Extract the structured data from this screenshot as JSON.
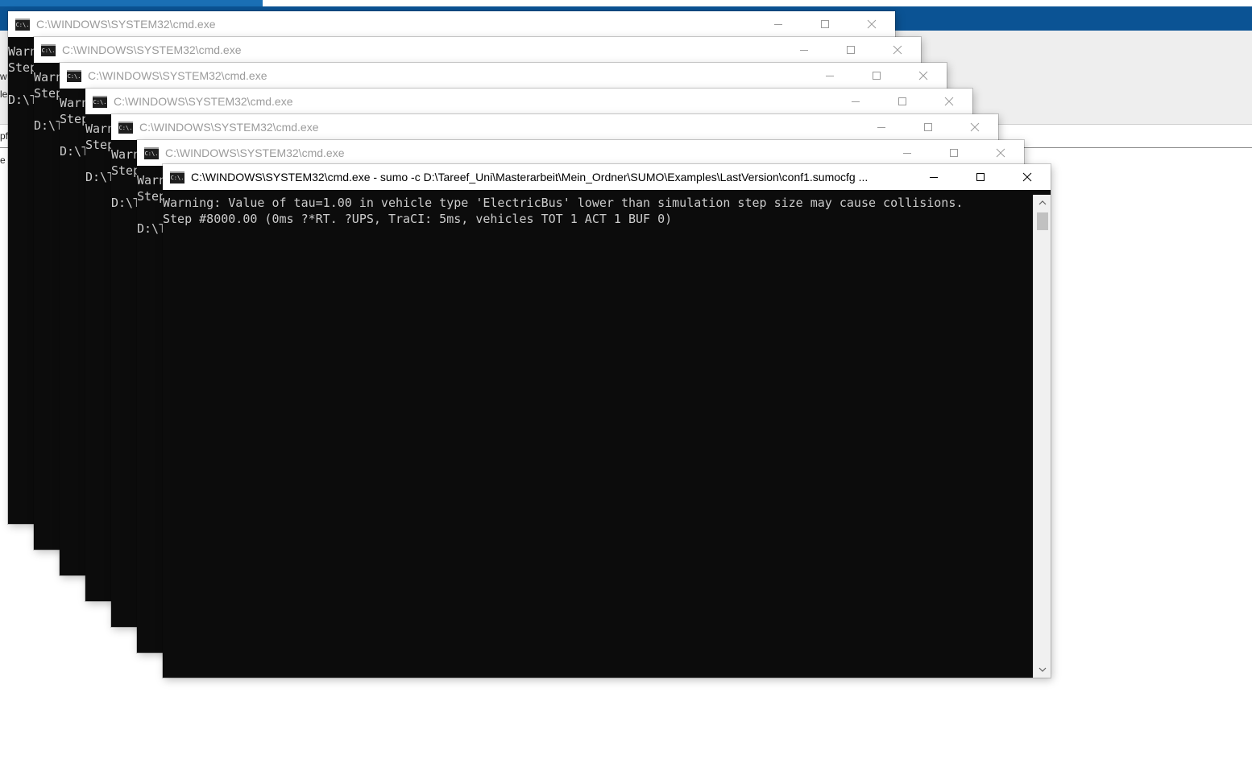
{
  "background_app": {
    "fragments": [
      "w",
      "le",
      "pf",
      "e"
    ]
  },
  "windows": [
    {
      "title": "C:\\WINDOWS\\SYSTEM32\\cmd.exe",
      "lines": [
        "Warn",
        "Step",
        "",
        "D:\\T"
      ]
    },
    {
      "title": "C:\\WINDOWS\\SYSTEM32\\cmd.exe",
      "lines": [
        "Warn",
        "Step",
        "",
        "D:\\T"
      ]
    },
    {
      "title": "C:\\WINDOWS\\SYSTEM32\\cmd.exe",
      "lines": [
        "Warn",
        "Step",
        "",
        "D:\\T"
      ]
    },
    {
      "title": "C:\\WINDOWS\\SYSTEM32\\cmd.exe",
      "lines": [
        "Warn",
        "Step",
        "",
        "D:\\T"
      ]
    },
    {
      "title": "C:\\WINDOWS\\SYSTEM32\\cmd.exe",
      "lines": [
        "Warn",
        "Step",
        "",
        "D:\\T"
      ]
    },
    {
      "title": "C:\\WINDOWS\\SYSTEM32\\cmd.exe",
      "lines": [
        "Warn",
        "Step",
        "",
        "D:\\T"
      ]
    }
  ],
  "front_window": {
    "title": "C:\\WINDOWS\\SYSTEM32\\cmd.exe - sumo  -c D:\\Tareef_Uni\\Masterarbeit\\Mein_Ordner\\SUMO\\Examples\\LastVersion\\conf1.sumocfg ...",
    "lines": [
      "Warning: Value of tau=1.00 in vehicle type 'ElectricBus' lower than simulation step size may cause collisions.",
      "Step #8000.00 (0ms ?*RT. ?UPS, TraCI: 5ms, vehicles TOT 1 ACT 1 BUF 0)"
    ]
  },
  "icons": {
    "app": "cmd-icon",
    "minimize": "minimize-icon",
    "maximize": "maximize-icon",
    "close": "close-icon"
  },
  "icon_label": "C:\\."
}
